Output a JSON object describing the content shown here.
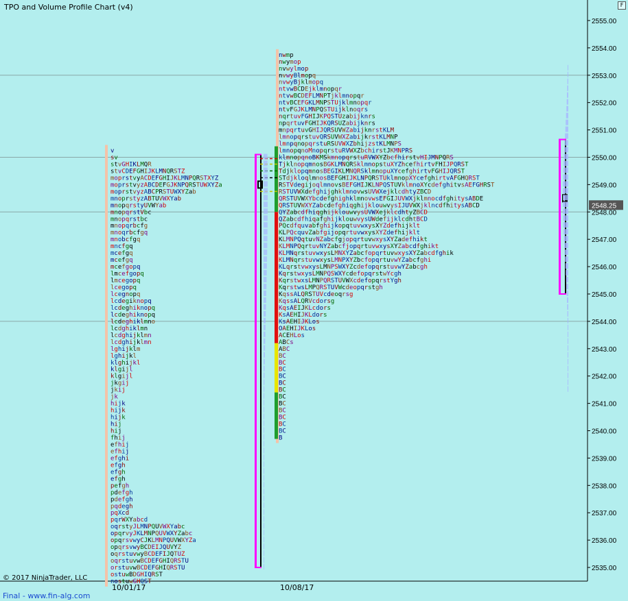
{
  "title": "TPO and Volume Profile Chart (v4)",
  "corner_button": "F",
  "copyright": "© 2017 NinjaTrader, LLC",
  "footer": "Final - www.fin-alg.com",
  "colors": {
    "background": "#b3eeee",
    "value_area": "#ff00ff",
    "poc_box": "#000000",
    "current_price_tag": "#555555",
    "volume_profile": "#a6b6ff"
  },
  "chart_data": {
    "type": "tpo-profile",
    "ylim": [
      2534.5,
      2555.6
    ],
    "yticks": [
      "2535.00",
      "2536.00",
      "2537.00",
      "2538.00",
      "2539.00",
      "2540.00",
      "2541.00",
      "2542.00",
      "2543.00",
      "2544.00",
      "2545.00",
      "2546.00",
      "2547.00",
      "2548.00",
      "2549.00",
      "2550.00",
      "2551.00",
      "2552.00",
      "2553.00",
      "2554.00",
      "2555.00"
    ],
    "last_price": "2548.25",
    "tick_size": 0.25,
    "dates": [
      "10/01/17",
      "10/08/17"
    ],
    "profiles": [
      {
        "date": "10/01/17",
        "high": 2550.25,
        "value_area": [
          2535.0,
          2550.1
        ],
        "poc": 2549.0,
        "rows_from_high": [
          "v",
          "sv",
          "stvGHIKLMQR",
          "stvCDEFGHIJKLMNQRSTZ",
          "moprstvyACDEFGHIJKLMNPQRSTXYZ",
          "moprstvyzABCDEFGJKNPQRSTUWXYZa",
          "moprstvyzABCPRSTUWXYZab",
          "mnoprstyzABTUVWXYab",
          "mnopqrstyUVWYab",
          "mnopqrstVbc",
          "mnopqrstbc",
          "mnopqrbcfg",
          "mnoqrbcfgq",
          "mnobcfgq",
          "mncfgq",
          "mcefgq",
          "mcefgq",
          "mcefgopq",
          "lmcefgopq",
          "lmcegopq",
          "lcegopq",
          "lcegnopq",
          "lcdegiknopq",
          "lcdeghiknopq",
          "lcdeghiknopq",
          "lcdeghiklmno",
          "lcdghiklmn",
          "lcdghijklmn",
          "lcdghijklmn",
          "lghijklm",
          "lghijkl",
          "klghijkl",
          "klgijl",
          "klgijl",
          "jkgij",
          "jkij",
          "jk",
          "hijk",
          "hijk",
          "hijk",
          "hij",
          "hij",
          "fhij",
          "efhij",
          "efhij",
          "efghi",
          "efgh",
          "efgh",
          "efgh",
          "pefgh",
          "pdefgh",
          "pdefgh",
          "pqdegh",
          "pqXcd",
          "pqrWXYabcd",
          "oqrstyJLMNPQUVWXYabc",
          "opqrvyJKLMNPQUVWXYZabc",
          "opqrsvwyCJKLMNPQUVWXYZa",
          "opqrsvwyBCDEIJQUVYZ",
          "oqrstuvwyBCDEFIJQTUZ",
          "oqrstuvwBCDEFGHIQRSTU",
          "orstuvwBCDEFGHIQRSTU",
          "ostuwBDGHIQRST",
          "nostuwGHQST"
        ]
      },
      {
        "date": "10/08/17",
        "high": 2553.75,
        "value_area": [
          2545.0,
          2550.65
        ],
        "poc": 2548.5,
        "rows_from_high": [
          "nwmp",
          "nwymop",
          "nvwylmop",
          "nvwyBlmopq",
          "nvwyBjklmopq",
          "ntvwBCDEjklmnopqr",
          "ntvwBCDEFLMNPTjklmnopqr",
          "ntvBCEFGKLMNPSTUjklmnopqr",
          "ntvFGJKLMNPQSTUijklnoqrs",
          "nqrtuvFGHIJKPQSTUzabijknrs",
          "npqrtuvFGHIJKQRSUZabijknrs",
          "mnpqrtuvGHIJQRSUVWZabijknrstKLM",
          "lmnopqrstuvQRSUVWXZabijkrstKLMNP",
          "lmnpqnopqrstuRSUVWXZbhijzstKLMNPS",
          "lmnopqnoMnopqrstuRVWXZbchirstJKMNPRS",
          "klmnopqnoBKMSkmnopqrstuRVWXYZbcfhirstvHIJMNPQRS",
          "TjklnopqmnosBGKLMNQRSklmnopstuXYZhcefhirtvFHIJPQRST",
          "TdjklopqmnosBEGIKLMNQRSklmnopuXYcefghirtvFGHIJQRST",
          "STdjkloqlmnosBEFGHIJKLNPQRSTUklmnopXYcefghirtvAFGHQRST",
          "RSTVdegijoqlmnovsBEFGHIJKLNPQSTUVklmnoXYcdefghitvsAEFGHRST",
          "RSTUVWXdefghijghklmnovwsUVWXejklcdhtyZBCD",
          "QRSTUVWXYbcdefghighklmnovwsEFGIJUVWXjklmnocdfghitysABDE",
          "QRSTUVWXYZabcdefghiqghijklouwvysIJUVWXjklncdfhitysABCD",
          "QYZabcdfhiqghijklouwvysUVWXejklcdhtyZBCD",
          "QZabcdfhiqafghijklouwvysUWdefijklcdhtBCD",
          "PQcdfquvabfghijkopqtuvwxysXYZdefhijklt",
          "KLPQcquvZabfgijopqrtuvwxysXYZdefhijklt",
          "KLMNPQqtuvNZabcfgjopqrtuvwxysXYZadefhikt",
          "KLMNPQqrtuvNYZabcfjopqrtuvwxysXYZabcdfghikt",
          "KLMNqrstuvwxysLMNXYZabcfopqrtuvwxysXYZabcdfghik",
          "KLMNqrstuvwxysLMNPXYZbcfopqrtuvwYZabcfghi",
          "KLqrstvwxysLMNPSWXYZcdefopqrstuvwYZabcgh",
          "KqrstwxysLMNPQSWXYcdefopqrstwYcgh",
          "KqrstwxsLMNPQRSTUVWXcdefopqrstYgh",
          "KqrstwsLMPQRSTUVWcdeopqrstgh",
          "KqssALQRSTUVcdeoqrsg",
          "KqssALQRVcdorsg",
          "KqsAEIJKLcdors",
          "KsAEHIJKLdors",
          "KsAEHIJKLos",
          "OAEHIJKLos",
          "ACEHLos",
          "ABCs",
          "ABC",
          "BC",
          "BC",
          "BC",
          "BC",
          "BC",
          "BC",
          "BC",
          "BC",
          "BC",
          "BC",
          "BC",
          "BC",
          "B"
        ]
      }
    ],
    "volume_profile": {
      "range": [
        2541.5,
        2553.3
      ],
      "peak": 2548.5
    }
  }
}
